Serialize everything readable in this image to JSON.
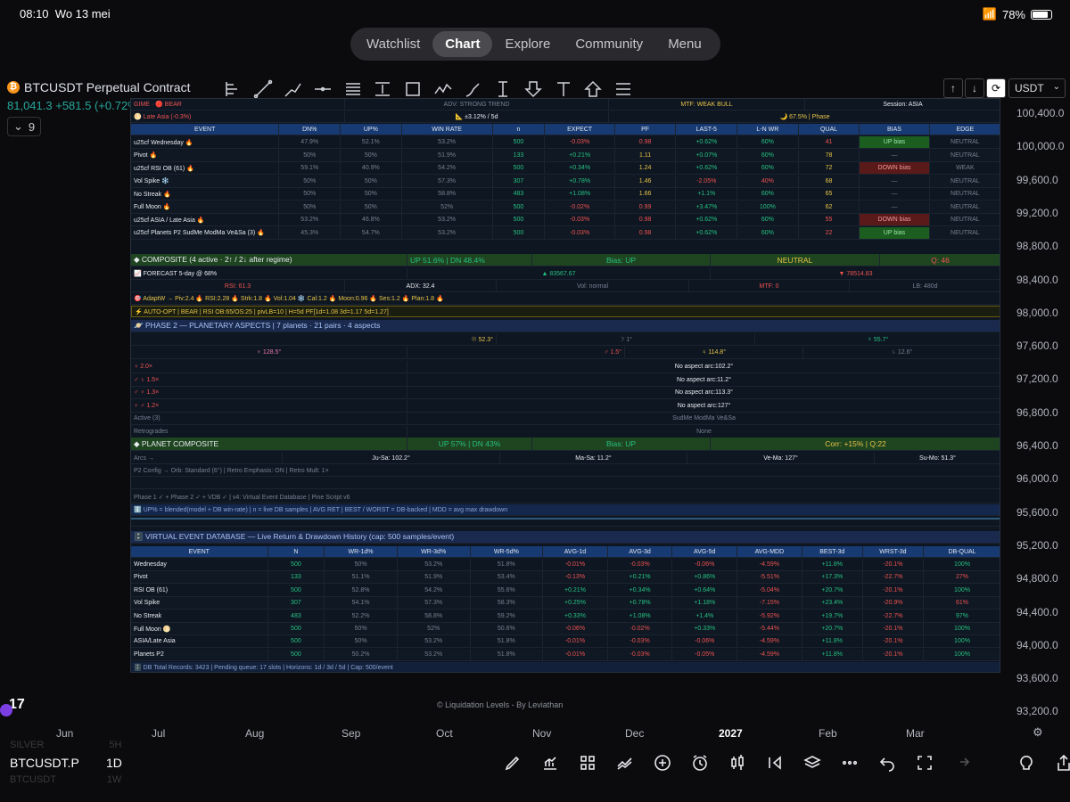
{
  "status": {
    "time": "08:10",
    "date": "Wo 13 mei",
    "battery": "78%"
  },
  "nav": {
    "items": [
      "Watchlist",
      "Chart",
      "Explore",
      "Community",
      "Menu"
    ],
    "active": "Chart"
  },
  "symbol": {
    "name": "BTCUSDT Perpetual Contract",
    "price": "81,041.3",
    "change": "+581.5 (+0.72%)",
    "indicator_count": "9",
    "currency": "USDT"
  },
  "price_axis": [
    "100,400.0",
    "100,000.0",
    "99,600.0",
    "99,200.0",
    "98,800.0",
    "98,400.0",
    "98,000.0",
    "97,600.0",
    "97,200.0",
    "96,800.0",
    "96,400.0",
    "96,000.0",
    "95,600.0",
    "95,200.0",
    "94,800.0",
    "94,400.0",
    "94,000.0",
    "93,600.0",
    "93,200.0"
  ],
  "time_axis": [
    "Jun",
    "Jul",
    "Aug",
    "Sep",
    "Oct",
    "Nov",
    "Dec",
    "2027",
    "Feb",
    "Mar"
  ],
  "panel": {
    "top": {
      "regime": "GIME · 🔴 BEAR",
      "trend": "ADV: STRONG TREND",
      "mtf": "MTF: WEAK BULL",
      "session": "Session: ASIA",
      "session_left": "🌕 Late Asia  (-0.3%)",
      "range": "📐 ±3.12% / 5d",
      "phase": "🌙 67.5% | Phase"
    },
    "event_headers": [
      "EVENT",
      "DN%",
      "UP%",
      "WIN RATE",
      "n",
      "EXPECT",
      "PF",
      "LAST-5",
      "L-N WR",
      "QUAL",
      "BIAS",
      "EDGE"
    ],
    "events": [
      [
        "u25cf Wednesday 🔥",
        "47.9%",
        "52.1%",
        "53.2%",
        "500",
        "-0.03%",
        "0.98",
        "+0.62%",
        "60%",
        "41",
        "UP bias",
        "NEUTRAL"
      ],
      [
        "Pivot 🔥",
        "50%",
        "50%",
        "51.9%",
        "133",
        "+0.21%",
        "1.11",
        "+0.07%",
        "60%",
        "78",
        "—",
        "NEUTRAL"
      ],
      [
        "u25cf RSI OB (61) 🔥",
        "59.1%",
        "40.9%",
        "54.2%",
        "500",
        "+0.34%",
        "1.24",
        "+0.62%",
        "60%",
        "72",
        "DOWN bias",
        "WEAK"
      ],
      [
        "Vol Spike ❄️",
        "50%",
        "50%",
        "57.3%",
        "307",
        "+0.78%",
        "1.46",
        "-2.05%",
        "40%",
        "68",
        "—",
        "NEUTRAL"
      ],
      [
        "No Streak 🔥",
        "50%",
        "50%",
        "58.8%",
        "483",
        "+1.08%",
        "1.66",
        "+1.1%",
        "60%",
        "65",
        "—",
        "NEUTRAL"
      ],
      [
        "Full Moon 🔥",
        "50%",
        "50%",
        "52%",
        "500",
        "-0.02%",
        "0.99",
        "+3.47%",
        "100%",
        "62",
        "—",
        "NEUTRAL"
      ],
      [
        "u25cf ASIA / Late Asia 🔥",
        "53.2%",
        "46.8%",
        "53.2%",
        "500",
        "-0.03%",
        "0.98",
        "+0.62%",
        "60%",
        "55",
        "DOWN bias",
        "NEUTRAL"
      ],
      [
        "u25cf Planets P2 SudMe ModMa Ve&Sa (3) 🔥",
        "45.3%",
        "54.7%",
        "53.2%",
        "500",
        "-0.03%",
        "0.98",
        "+0.62%",
        "60%",
        "22",
        "UP bias",
        "NEUTRAL"
      ]
    ],
    "composite": {
      "title": "◆ COMPOSITE  (4 active · 2↑ / 2↓ after regime)",
      "updn": "UP 51.6%  |  DN 48.4%",
      "bias": "Bias: UP",
      "state": "NEUTRAL",
      "q": "Q: 46"
    },
    "forecast": {
      "label": "📈 FORECAST  5-day @ 68%",
      "up": "▲ 83567.67",
      "dn": "▼ 78514.83"
    },
    "stats": {
      "rsi": "RSI: 61.3",
      "adx": "ADX: 32.4",
      "vol": "Vol: normal",
      "mtf": "MTF: 0",
      "lb": "LB: 480d"
    },
    "adapt": "🎯 AdaptW → Piv:2.4 🔥  RSI:2.28 🔥  Strk:1.8 🔥  Vol:1.04 ❄️  Cal:1.2 🔥  Moon:0.96 🔥  Ses:1.2 🔥  Plan:1.8 🔥",
    "autoopt": "⚡ AUTO-OPT | BEAR | RSI OB:65/OS:25  |  pivLB=10  |  H=5d PF[1d=1.08 3d=1.17 5d=1.27]",
    "phase2": {
      "title": "🪐 PHASE 2 — PLANETARY ASPECTS  |  7 planets · 21 pairs · 4 aspects",
      "p1": "☉ 52.3°",
      "p2": "☽ 1°",
      "p3": "☿ 55.7°",
      "p4": "♀ 128.5°",
      "p5": "♂ 1.5°",
      "p6": "♃ 114.8°",
      "p7": "♄ 12.6°"
    },
    "aspects": [
      [
        "♃  2.0×",
        "No aspect  arc:102.2°"
      ],
      [
        "♂ ♄  1.5×",
        "No aspect  arc:11.2°"
      ],
      [
        "♂ ♀  1.3×",
        "No aspect  arc:113.3°"
      ],
      [
        "♀ ♂  1.2×",
        "No aspect  arc:127°"
      ],
      [
        "Active (3)",
        "SudMe ModMa Ve&Sa"
      ],
      [
        "Retrogrades",
        "None"
      ]
    ],
    "planet_comp": {
      "title": "◆ PLANET COMPOSITE",
      "updn": "UP 57%  |  DN 43%",
      "bias": "Bias: UP",
      "corr": "Corr: +15% | Q:22"
    },
    "arcs": {
      "label": "Arcs →",
      "a1": "Ju-Sa: 102.2°",
      "a2": "Ma-Sa: 11.2°",
      "a3": "Ve-Ma: 127°",
      "a4": "Su-Mo: 51.3°"
    },
    "pconfig": "P2 Config → Orb: Standard (6°)  |  Retro Emphasis: ON  |  Retro Mult: 1×",
    "phase_line": "Phase 1 ✓ + Phase 2 ✓ + VDB ✓  |  v4: Virtual Event Database  |  Pine Script v6",
    "info_line": "ℹ️  UP% = blended(model + DB win-rate)  |  n = live DB samples  |  AVG RET | BEST / WORST = DB-backed  |  MDD = avg max drawdown",
    "vdb_title": "🗄️ VIRTUAL EVENT DATABASE  —  Live Return & Drawdown History  (cap: 500 samples/event)",
    "vdb_headers": [
      "EVENT",
      "N",
      "WR-1d%",
      "WR-3d%",
      "WR-5d%",
      "AVG-1d",
      "AVG-3d",
      "AVG-5d",
      "AVG-MDD",
      "BEST-3d",
      "WRST-3d",
      "DB-QUAL"
    ],
    "vdb": [
      [
        "Wednesday",
        "500",
        "50%",
        "53.2%",
        "51.8%",
        "-0.01%",
        "-0.03%",
        "-0.06%",
        "-4.59%",
        "+11.8%",
        "-20.1%",
        "100%"
      ],
      [
        "Pivot",
        "133",
        "51.1%",
        "51.9%",
        "53.4%",
        "-0.13%",
        "+0.21%",
        "+0.86%",
        "-5.51%",
        "+17.3%",
        "-22.7%",
        "27%"
      ],
      [
        "RSI OB (61)",
        "500",
        "52.8%",
        "54.2%",
        "55.6%",
        "+0.21%",
        "+0.34%",
        "+0.64%",
        "-5.04%",
        "+20.7%",
        "-20.1%",
        "100%"
      ],
      [
        "Vol Spike",
        "307",
        "54.1%",
        "57.3%",
        "58.3%",
        "+0.25%",
        "+0.78%",
        "+1.18%",
        "-7.15%",
        "+23.4%",
        "-20.9%",
        "61%"
      ],
      [
        "No Streak",
        "483",
        "52.2%",
        "58.8%",
        "59.2%",
        "+0.33%",
        "+1.08%",
        "+1.4%",
        "-5.92%",
        "+19.7%",
        "-22.7%",
        "97%"
      ],
      [
        "Full Moon 🌕",
        "500",
        "50%",
        "52%",
        "50.6%",
        "-0.06%",
        "-0.02%",
        "+0.33%",
        "-5.44%",
        "+20.7%",
        "-20.1%",
        "100%"
      ],
      [
        "ASIA/Late Asia",
        "500",
        "50%",
        "53.2%",
        "51.8%",
        "-0.01%",
        "-0.03%",
        "-0.06%",
        "-4.59%",
        "+11.8%",
        "-20.1%",
        "100%"
      ],
      [
        "Planets P2",
        "500",
        "50.2%",
        "53.2%",
        "51.8%",
        "-0.01%",
        "-0.03%",
        "-0.05%",
        "-4.59%",
        "+11.8%",
        "-20.1%",
        "100%"
      ]
    ],
    "db_footer": "🗄️ DB Total Records: 3423  |  Pending queue: 17 slots  |  Horizons: 1d / 3d / 5d  |  Cap: 500/event"
  },
  "footer_credit": "© Liquidation Levels - By Leviathan",
  "bottom": {
    "symbol": "BTCUSDT.P",
    "interval": "1D",
    "ghost1": "SILVER",
    "ghost1b": "5H",
    "ghost2": "BTCUSDT",
    "ghost2b": "1W"
  }
}
